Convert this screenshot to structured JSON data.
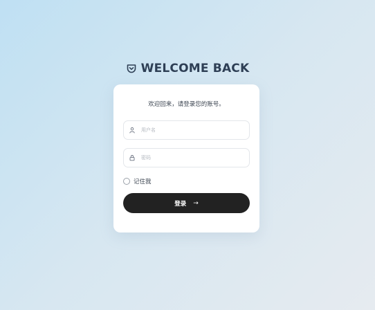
{
  "header": {
    "title": "WELCOME BACK",
    "logo_icon": "pocket-shield-icon"
  },
  "card": {
    "subtitle": "欢迎回来，请登录您的账号。",
    "username": {
      "placeholder": "用户名",
      "value": "",
      "icon": "user-icon"
    },
    "password": {
      "placeholder": "密码",
      "value": "",
      "icon": "lock-icon"
    },
    "remember": {
      "label": "记住我",
      "checked": false
    },
    "login_button": {
      "label": "登录",
      "icon": "arrow-right-icon"
    }
  },
  "colors": {
    "accent": "#222222",
    "title": "#2e3f55",
    "background_start": "#bfe0f3",
    "background_end": "#e6ebf0"
  }
}
